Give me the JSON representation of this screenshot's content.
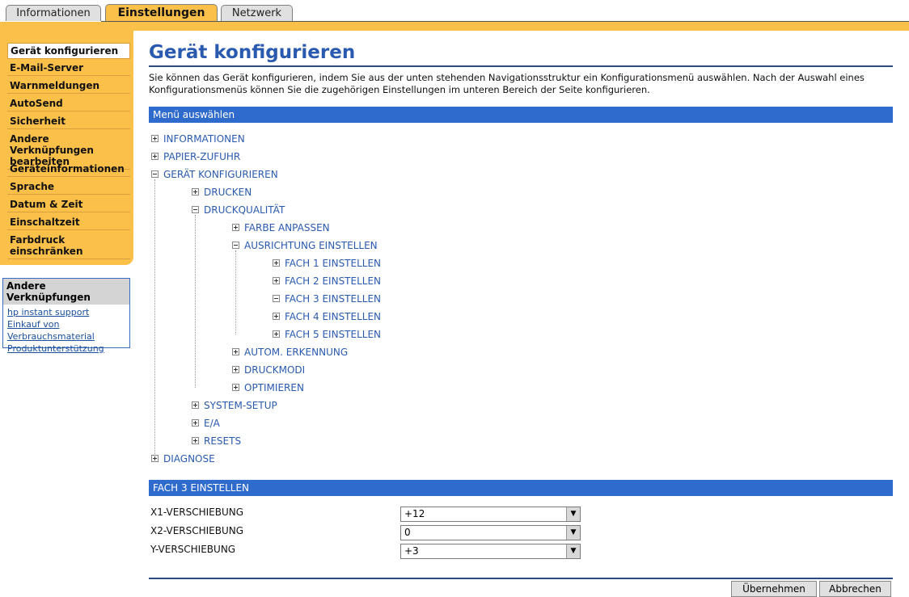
{
  "tabs": [
    "Informationen",
    "Einstellungen",
    "Netzwerk"
  ],
  "leftnav": {
    "items": [
      "Gerät konfigurieren",
      "E-Mail-Server",
      "Warnmeldungen",
      "AutoSend",
      "Sicherheit",
      "Andere Verknüpfungen bearbeiten",
      "Geräteinformationen",
      "Sprache",
      "Datum & Zeit",
      "Einschaltzeit",
      "Farbdruck einschränken"
    ]
  },
  "links": {
    "header": "Andere Verknüpfungen",
    "items": [
      "hp instant support",
      "Einkauf von Verbrauchsmaterial",
      "Produktunterstützung"
    ]
  },
  "main": {
    "title": "Gerät konfigurieren",
    "intro": "Sie können das Gerät konfigurieren, indem Sie aus der unten stehenden Navigationsstruktur ein Konfigurationsmenü auswählen. Nach der Auswahl eines Konfigurationsmenüs können Sie die zugehörigen Einstellungen im unteren Bereich der Seite konfigurieren.",
    "menu_header": "Menü auswählen",
    "tree": [
      "INFORMATIONEN",
      "PAPIER-ZUFUHR",
      "GERÄT KONFIGURIEREN",
      "DRUCKEN",
      "DRUCKQUALITÄT",
      "FARBE ANPASSEN",
      "AUSRICHTUNG EINSTELLEN",
      "FACH 1 EINSTELLEN",
      "FACH 2 EINSTELLEN",
      "FACH 3 EINSTELLEN",
      "FACH 4 EINSTELLEN",
      "FACH 5 EINSTELLEN",
      "AUTOM. ERKENNUNG",
      "DRUCKMODI",
      "OPTIMIEREN",
      "SYSTEM-SETUP",
      "E/A",
      "RESETS",
      "DIAGNOSE"
    ],
    "section_header": "FACH 3 EINSTELLEN",
    "fields": [
      {
        "label": "X1-VERSCHIEBUNG",
        "value": "+12"
      },
      {
        "label": "X2-VERSCHIEBUNG",
        "value": "0"
      },
      {
        "label": "Y-VERSCHIEBUNG",
        "value": "+3"
      }
    ],
    "buttons": [
      "Übernehmen",
      "Abbrechen"
    ]
  },
  "colors": {
    "accent": "#fbc04a",
    "blue": "#2f6bcc",
    "link": "#2a5ab0"
  }
}
